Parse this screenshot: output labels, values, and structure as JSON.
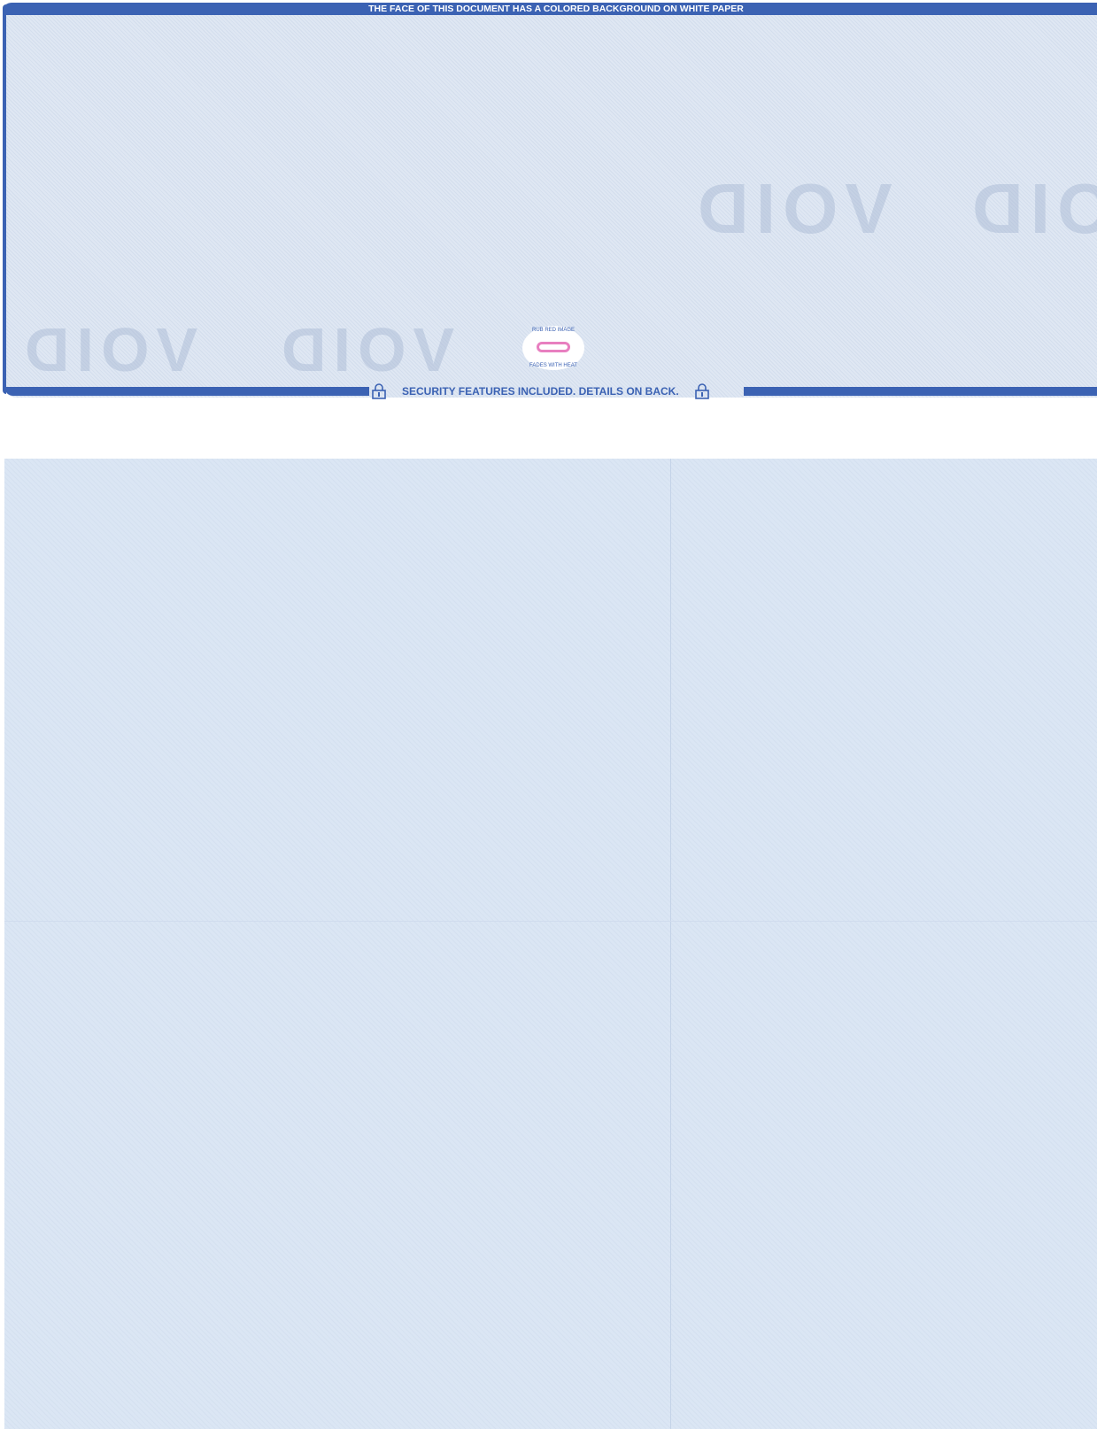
{
  "header": {
    "notice": "THE FACE OF THIS DOCUMENT HAS A COLORED BACKGROUND ON WHITE PAPER"
  },
  "watermark": {
    "text": "VOID"
  },
  "seal": {
    "top_text": "RUB RED IMAGE",
    "bottom_text": "FADES WITH HEAT"
  },
  "footer": {
    "security_text": "SECURITY FEATURES INCLUDED. DETAILS ON BACK."
  },
  "colors": {
    "brand_blue": "#3b62b3",
    "background": "#dfe7f3",
    "seal_ink": "#e87fc0"
  }
}
